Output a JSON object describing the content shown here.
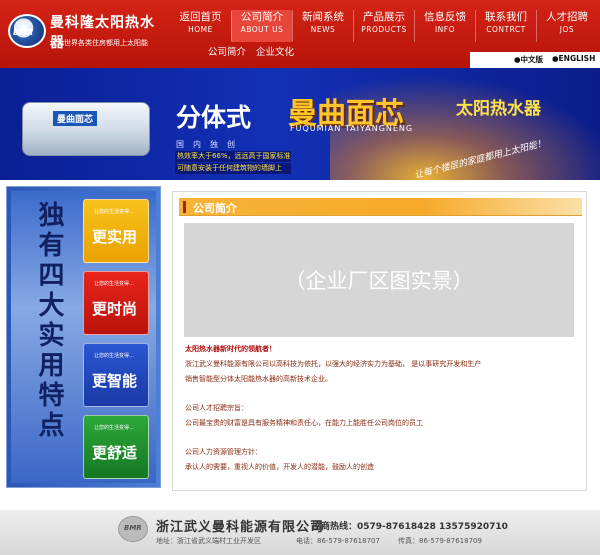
{
  "header": {
    "logo_badge": "BMR",
    "logo_title": "曼科隆太阳热水器",
    "logo_sub": "让全世界各类住房都用上太阳能",
    "nav": [
      {
        "cn": "返回首页",
        "en": "HOME"
      },
      {
        "cn": "公司简介",
        "en": "ABOUT US"
      },
      {
        "cn": "新闻系统",
        "en": "NEWS"
      },
      {
        "cn": "产品展示",
        "en": "PRODUCTS"
      },
      {
        "cn": "信息反馈",
        "en": "INFO"
      },
      {
        "cn": "联系我们",
        "en": "CONTRCT"
      },
      {
        "cn": "人才招聘",
        "en": "JOS"
      }
    ],
    "subnav": [
      "公司简介",
      "企业文化"
    ],
    "lang_cn": "●中文版",
    "lang_en": "●ENGLISH"
  },
  "banner": {
    "tank_label": "曼曲面芯",
    "title": "分体式",
    "brand": "曼曲面芯",
    "product": "太阳热水器",
    "pinyin": "FUQUMIAN TAIYANGNENG",
    "unique": "国内独创",
    "feature1": "热效率大于66%，远远高于国家标准",
    "feature2": "可随意安装于任何建筑物的墙脚上",
    "slogan": "让每个楼层的家庭都用上太阳能！"
  },
  "left": {
    "vertical_title": "独有四大实用特点",
    "cards": [
      {
        "small": "让您的生活变得…",
        "big": "更实用"
      },
      {
        "small": "让您的生活变得…",
        "big": "更时尚"
      },
      {
        "small": "让您的生活变得…",
        "big": "更智能"
      },
      {
        "small": "让您的生活变得…",
        "big": "更舒适"
      }
    ]
  },
  "main": {
    "heading": "公司简介",
    "photo_placeholder": "（企业厂区图实景）",
    "para_title": "太阳热水器新时代的领航者！",
    "para1": "浙江武义曼科能源有限公司以高科技为依托，以强大的经济实力为基础，  是以事研究开发和生产",
    "para2": "销售智能型分体太阳能热水器的高新技术企业。",
    "talent_title": "公司人才招聘宗旨：",
    "talent_text": "公司最宝贵的财富是具有服务精神和责任心，在能力上能胜任公司岗位的员工",
    "hr_title": "公司人力资源管理方针：",
    "hr_text": "承认人的需要，重视人的价值，开发人的潜能，鼓励人的创造"
  },
  "footer": {
    "logo_badge": "BMR",
    "company": "浙江武义曼科能源有限公司",
    "hotline": "招商热线：0579-87618428  13575920710",
    "address": "地址：浙江省武义端村工业开发区",
    "tel": "电话：86-579-87618707",
    "fax": "传真：86-579-87618709"
  }
}
